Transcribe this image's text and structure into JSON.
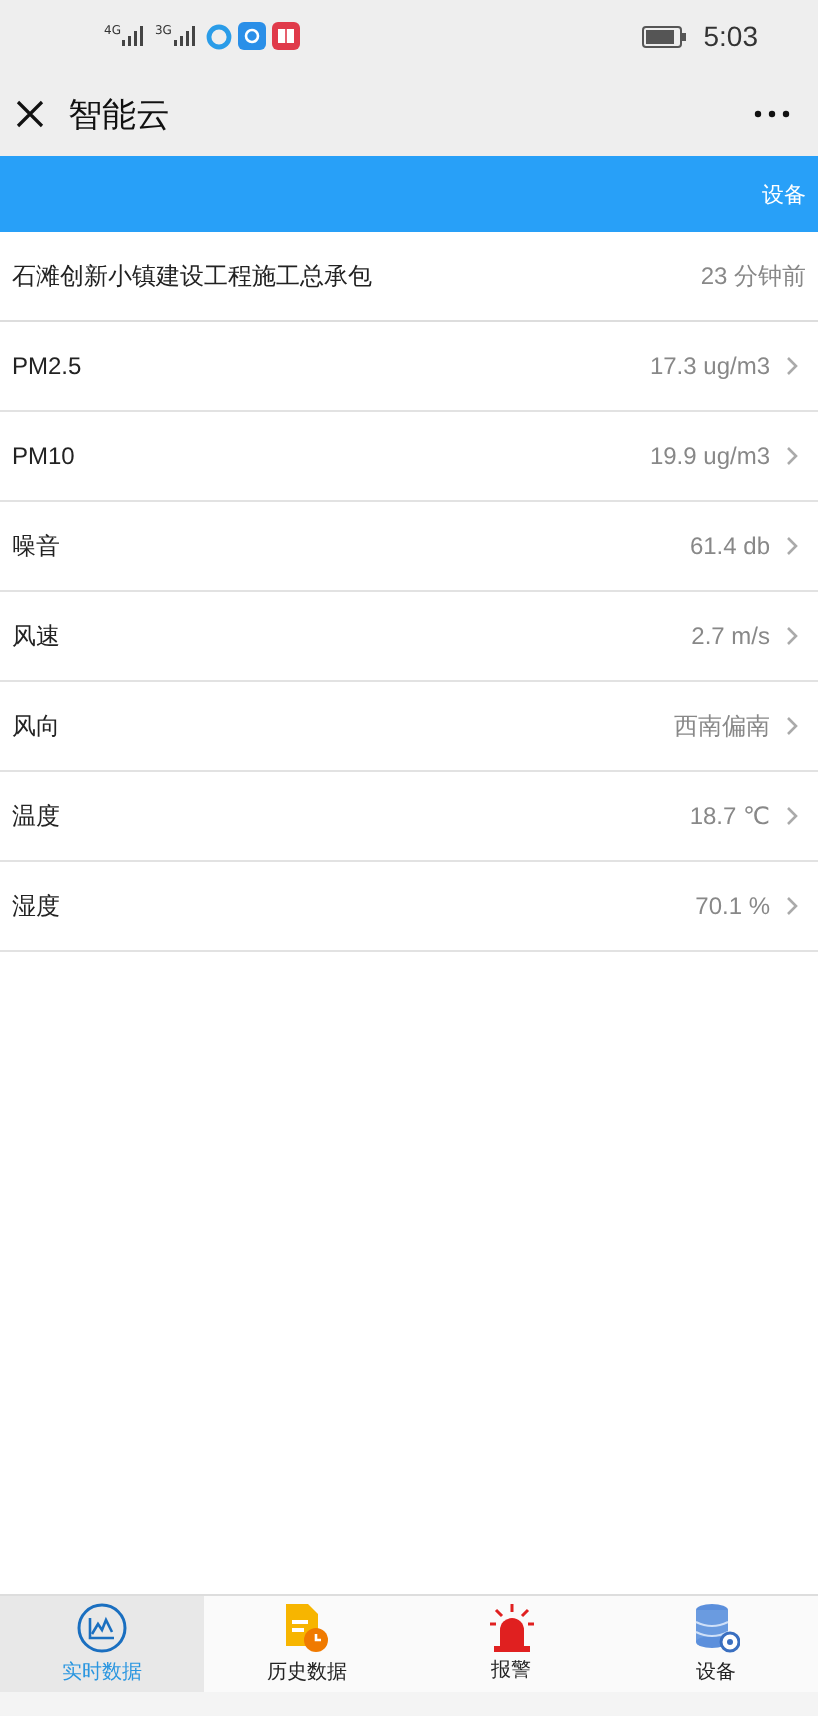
{
  "status_bar": {
    "signals": [
      "4G",
      "3G"
    ],
    "time": "5:03"
  },
  "header": {
    "title": "智能云"
  },
  "toolbar": {
    "action": "设备"
  },
  "project": {
    "name": "石滩创新小镇建设工程施工总承包",
    "updated": "23 分钟前"
  },
  "readings": [
    {
      "label": "PM2.5",
      "value": "17.3 ug/m3"
    },
    {
      "label": "PM10",
      "value": "19.9 ug/m3"
    },
    {
      "label": "噪音",
      "value": "61.4 db"
    },
    {
      "label": "风速",
      "value": "2.7 m/s"
    },
    {
      "label": "风向",
      "value": "西南偏南"
    },
    {
      "label": "温度",
      "value": "18.7 ℃"
    },
    {
      "label": "湿度",
      "value": "70.1 %"
    }
  ],
  "tabs": [
    {
      "label": "实时数据",
      "kind": "chart",
      "selected": true
    },
    {
      "label": "历史数据",
      "kind": "history",
      "selected": false
    },
    {
      "label": "报警",
      "kind": "alarm",
      "selected": false
    },
    {
      "label": "设备",
      "kind": "device",
      "selected": false
    }
  ]
}
